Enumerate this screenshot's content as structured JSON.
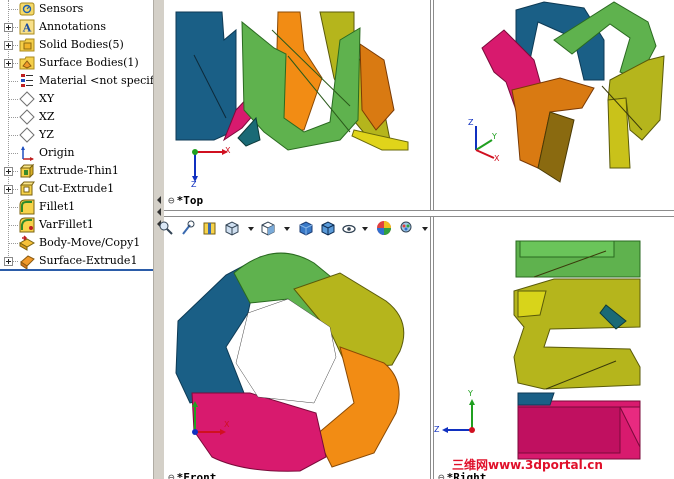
{
  "feature_tree": {
    "items": [
      {
        "label": "Sensors",
        "icon": "sensors-icon",
        "expandable": false
      },
      {
        "label": "Annotations",
        "icon": "annotations-icon",
        "expandable": true
      },
      {
        "label": "Solid Bodies(5)",
        "icon": "solid-bodies-folder-icon",
        "expandable": true
      },
      {
        "label": "Surface Bodies(1)",
        "icon": "surface-bodies-folder-icon",
        "expandable": true
      },
      {
        "label": "Material <not specified>",
        "icon": "material-icon",
        "expandable": false
      },
      {
        "label": "XY",
        "icon": "plane-icon",
        "expandable": false
      },
      {
        "label": "XZ",
        "icon": "plane-icon",
        "expandable": false
      },
      {
        "label": "YZ",
        "icon": "plane-icon",
        "expandable": false
      },
      {
        "label": "Origin",
        "icon": "origin-icon",
        "expandable": false
      },
      {
        "label": "Extrude-Thin1",
        "icon": "extrude-icon",
        "expandable": true
      },
      {
        "label": "Cut-Extrude1",
        "icon": "cut-extrude-icon",
        "expandable": true
      },
      {
        "label": "Fillet1",
        "icon": "fillet-icon",
        "expandable": false
      },
      {
        "label": "VarFillet1",
        "icon": "variable-fillet-icon",
        "expandable": false
      },
      {
        "label": "Body-Move/Copy1",
        "icon": "body-move-icon",
        "expandable": false
      },
      {
        "label": "Surface-Extrude1",
        "icon": "surface-extrude-icon",
        "expandable": true
      }
    ]
  },
  "viewports": {
    "top": {
      "label": "*Top"
    },
    "front": {
      "label": "*Front"
    },
    "right": {
      "label": "*Right"
    }
  },
  "axes": {
    "x": "X",
    "y": "Y",
    "z": "Z"
  },
  "toolbar": {
    "icons": [
      "zoom-to-fit-icon",
      "zoom-area-icon",
      "section-view-icon",
      "view-orientation-icon",
      "display-style-icon",
      "shaded-icon",
      "shaded-edges-icon",
      "hide-show-icon",
      "appearance-icon",
      "scene-icon"
    ]
  },
  "watermark": {
    "text": "三维网www.3dportal.cn"
  },
  "colors": {
    "blue": "#1a5f86",
    "green": "#5fb24e",
    "olive": "#b5b51c",
    "orange": "#f28c14",
    "magenta": "#d81a6e",
    "tree_accent": "#2b5ca8",
    "watermark": "#e0102a"
  }
}
